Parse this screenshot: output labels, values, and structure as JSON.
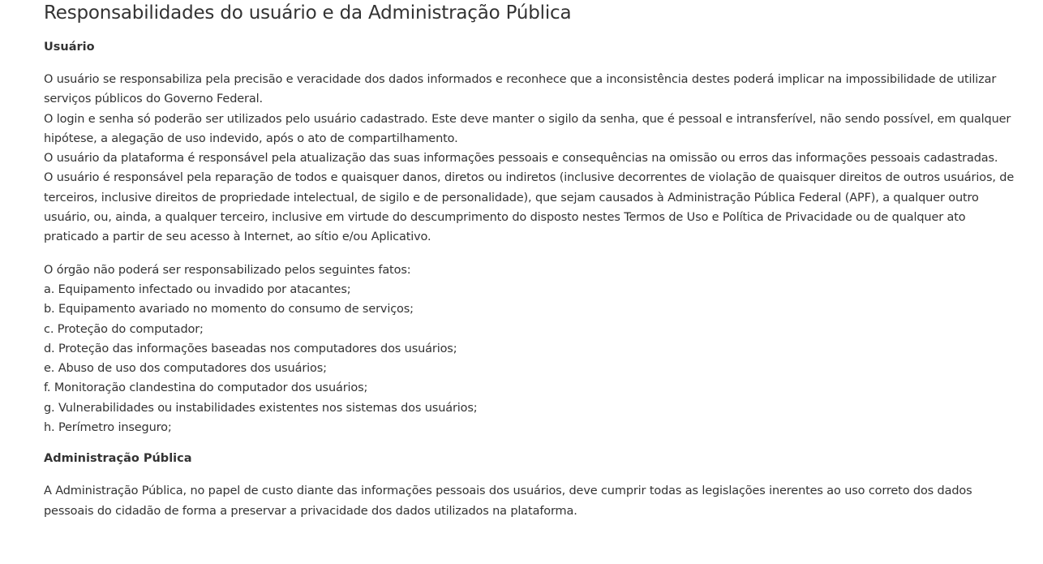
{
  "page_title": "Responsabilidades do usuário e da Administração Pública",
  "usuario": {
    "heading": "Usuário",
    "paragraphs": [
      "O usuário se responsabiliza pela precisão e veracidade dos dados informados e reconhece que a inconsistência destes poderá implicar na impossibilidade de utilizar serviços públicos do Governo Federal.",
      "O login e senha só poderão ser utilizados pelo usuário cadastrado. Este deve manter o sigilo da senha, que é pessoal e intransferível, não sendo possível, em qualquer hipótese, a alegação de uso indevido, após o ato de compartilhamento.",
      "O usuário da plataforma é responsável pela atualização das suas informações pessoais e consequências na omissão ou erros das informações pessoais cadastradas.",
      "O usuário é responsável pela reparação de todos e quaisquer danos, diretos ou indiretos (inclusive decorrentes de violação de quaisquer direitos de outros usuários, de terceiros, inclusive direitos de propriedade intelectual, de sigilo e de personalidade), que sejam causados à Administração Pública Federal (APF), a qualquer outro usuário, ou, ainda, a qualquer terceiro, inclusive em virtude do descumprimento do disposto nestes Termos de Uso e Política de Privacidade ou de qualquer ato praticado a partir de seu acesso à Internet, ao sítio e/ou Aplicativo."
    ]
  },
  "orgao": {
    "intro": "O órgão não poderá ser responsabilizado pelos seguintes fatos:",
    "items": [
      "a. Equipamento infectado ou invadido por atacantes;",
      "b. Equipamento avariado no momento do consumo de serviços;",
      "c. Proteção do computador;",
      "d. Proteção das informações baseadas nos computadores dos usuários;",
      "e. Abuso de uso dos computadores dos usuários;",
      "f. Monitoração clandestina do computador dos usuários;",
      "g. Vulnerabilidades ou instabilidades existentes nos sistemas dos usuários;",
      "h. Perímetro inseguro;"
    ]
  },
  "administracao": {
    "heading": "Administração Pública",
    "paragraph": "A Administração Pública, no papel de custo diante das informações pessoais dos usuários, deve cumprir todas as legislações inerentes ao uso correto dos dados pessoais do cidadão de forma a preservar a privacidade dos dados utilizados na plataforma."
  }
}
